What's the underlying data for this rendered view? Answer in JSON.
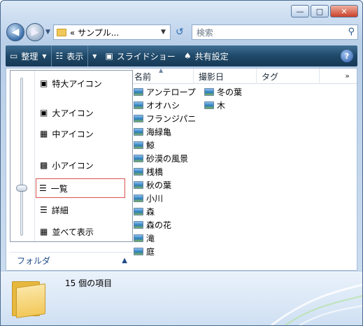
{
  "address": {
    "text": "« サンプル..."
  },
  "search": {
    "placeholder": "検索"
  },
  "toolbar": {
    "organize": "整理",
    "views": "表示",
    "slideshow": "スライドショー",
    "share": "共有設定"
  },
  "view_menu": {
    "items": [
      {
        "label": "特大アイコン"
      },
      {
        "label": "大アイコン"
      },
      {
        "label": "中アイコン"
      },
      {
        "label": "小アイコン"
      },
      {
        "label": "一覧",
        "selected": true
      },
      {
        "label": "詳細"
      },
      {
        "label": "並べて表示"
      }
    ]
  },
  "folders_label": "フォルダ",
  "columns": [
    "名前",
    "撮影日",
    "タグ"
  ],
  "files": [
    "アンテロープ",
    "オオハシ",
    "フランジパニ",
    "海緑亀",
    "鯨",
    "砂漠の風景",
    "桟橋",
    "秋の葉",
    "小川",
    "森",
    "森の花",
    "滝",
    "庭",
    "冬の葉",
    "木"
  ],
  "status": {
    "count": "15 個の項目"
  },
  "colors": {
    "toolbar": "#1f4868",
    "selection_outline": "#d9534f",
    "link": "#1e4b88"
  }
}
